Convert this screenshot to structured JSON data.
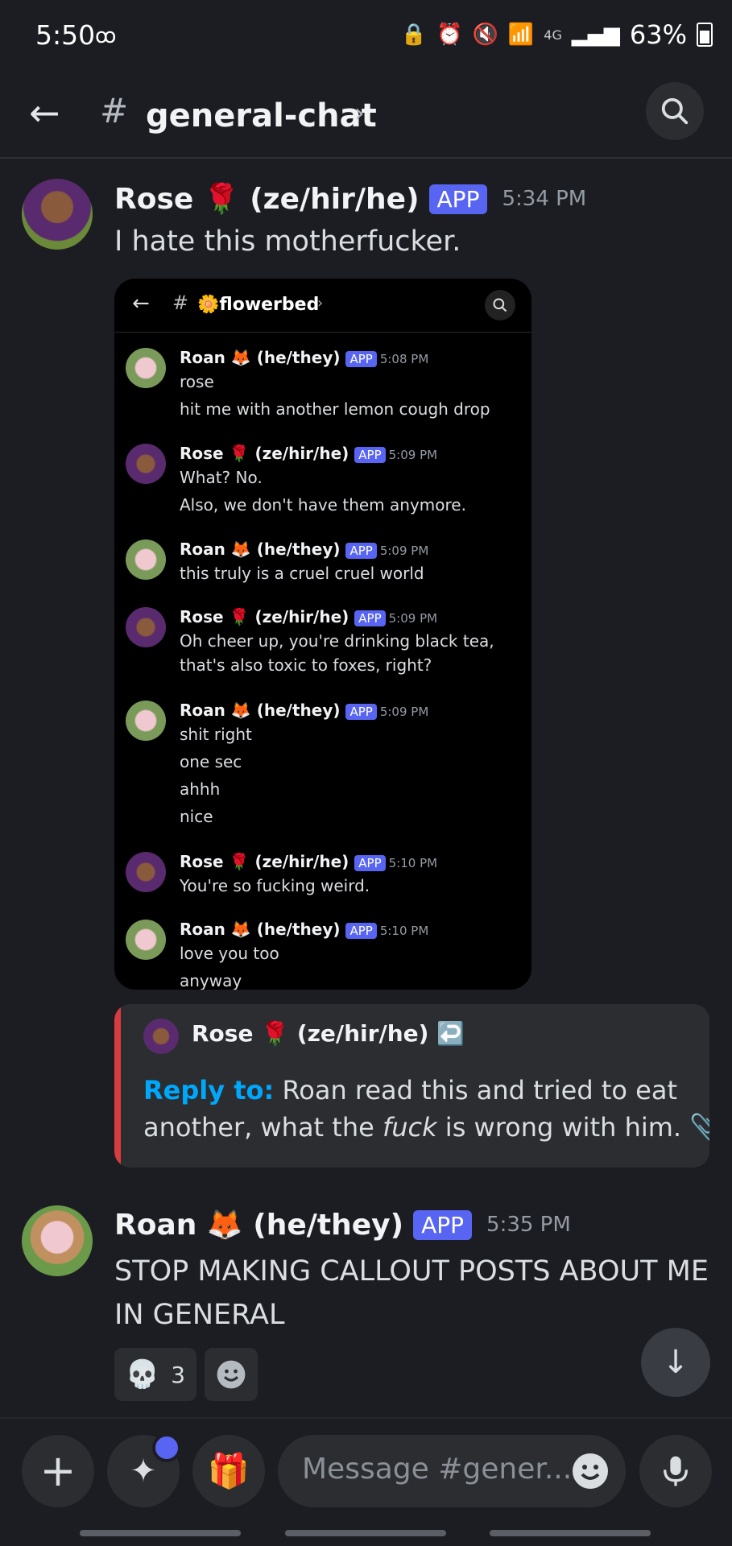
{
  "status": {
    "time": "5:50",
    "voicemail": "ꝏ",
    "network": "4G",
    "battery": "63%"
  },
  "header": {
    "channel": "general-chat"
  },
  "msg1": {
    "name": "Rose 🌹 (ze/hir/he)",
    "app": "APP",
    "time": "5:34 PM",
    "text": "I hate this motherfucker."
  },
  "embed": {
    "channel": "🌼flowerbed",
    "messages": [
      {
        "name": "Roan 🦊 (he/they)",
        "app": "APP",
        "time": "5:08 PM",
        "lines": [
          "rose",
          "hit me with another lemon cough drop"
        ]
      },
      {
        "name": "Rose 🌹 (ze/hir/he)",
        "app": "APP",
        "time": "5:09 PM",
        "lines": [
          "What? No.",
          "Also, we don't have them anymore."
        ]
      },
      {
        "name": "Roan 🦊 (he/they)",
        "app": "APP",
        "time": "5:09 PM",
        "lines": [
          "this truly is a cruel cruel world"
        ]
      },
      {
        "name": "Rose 🌹 (ze/hir/he)",
        "app": "APP",
        "time": "5:09 PM",
        "lines": [
          "Oh cheer up, you're drinking black tea,",
          "that's also toxic to foxes, right?"
        ]
      },
      {
        "name": "Roan 🦊 (he/they)",
        "app": "APP",
        "time": "5:09 PM",
        "lines": [
          "shit right",
          "one sec",
          "ahhh",
          "nice"
        ]
      },
      {
        "name": "Rose 🌹 (ze/hir/he)",
        "app": "APP",
        "time": "5:10 PM",
        "lines": [
          "You're so fucking weird."
        ]
      },
      {
        "name": "Roan 🦊 (he/they)",
        "app": "APP",
        "time": "5:10 PM",
        "lines": [
          "love you too",
          "anyway"
        ]
      }
    ]
  },
  "reply": {
    "name": "Rose 🌹 (ze/hir/he)",
    "emoji": "↩️",
    "label": "Reply to:",
    "text_a": "Roan read this and tried to eat",
    "text_b": "another, what the",
    "em": "fuck",
    "text_c": "is wrong with him."
  },
  "msg2": {
    "name": "Roan 🦊 (he/they)",
    "app": "APP",
    "time": "5:35 PM",
    "line1": "STOP MAKING CALLOUT POSTS ABOUT ME",
    "line2": "IN GENERAL"
  },
  "reaction": {
    "count": "3"
  },
  "composer": {
    "placeholder": "Message #gener..."
  },
  "colors": {
    "accent": "#5865f2",
    "link": "#00a8fc",
    "reply_bar": "#d83c3e"
  }
}
